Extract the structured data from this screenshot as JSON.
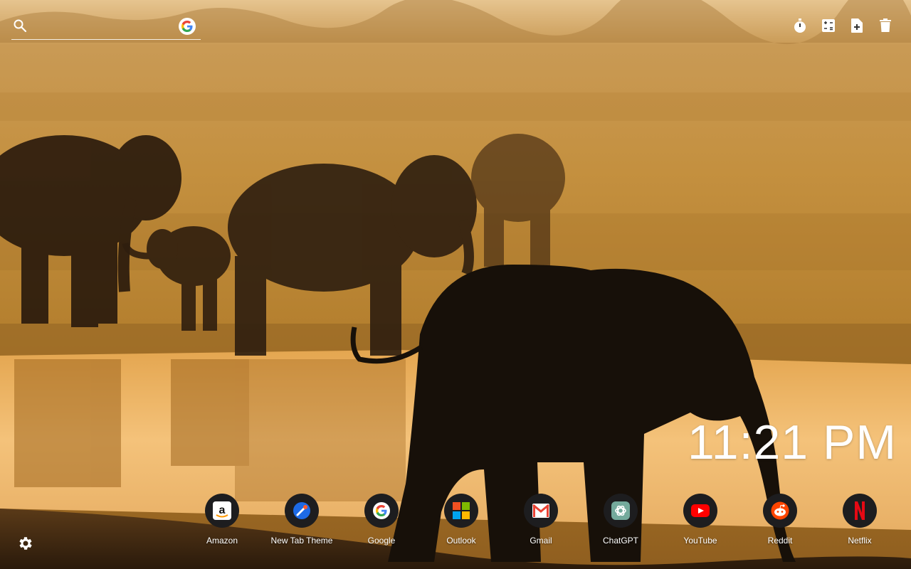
{
  "search": {
    "placeholder": "",
    "engine_icon": "google-g-icon"
  },
  "toolbar": {
    "icons": [
      "stopwatch-icon",
      "calculator-icon",
      "document-plus-icon",
      "trash-icon"
    ]
  },
  "clock": {
    "time": "11:21 PM"
  },
  "shortcuts": [
    {
      "label": "Amazon",
      "icon": "amazon-icon"
    },
    {
      "label": "New Tab Theme",
      "icon": "new-tab-theme-icon"
    },
    {
      "label": "Google",
      "icon": "google-icon"
    },
    {
      "label": "Outlook",
      "icon": "microsoft-icon"
    },
    {
      "label": "Gmail",
      "icon": "gmail-icon"
    },
    {
      "label": "ChatGPT",
      "icon": "chatgpt-icon"
    },
    {
      "label": "YouTube",
      "icon": "youtube-icon"
    },
    {
      "label": "Reddit",
      "icon": "reddit-icon"
    },
    {
      "label": "Netflix",
      "icon": "netflix-icon"
    }
  ],
  "settings": {
    "icon": "gear-icon"
  },
  "colors": {
    "sky": "#d9a557",
    "water": "#f0b560",
    "silhouette": "#1c130b"
  }
}
